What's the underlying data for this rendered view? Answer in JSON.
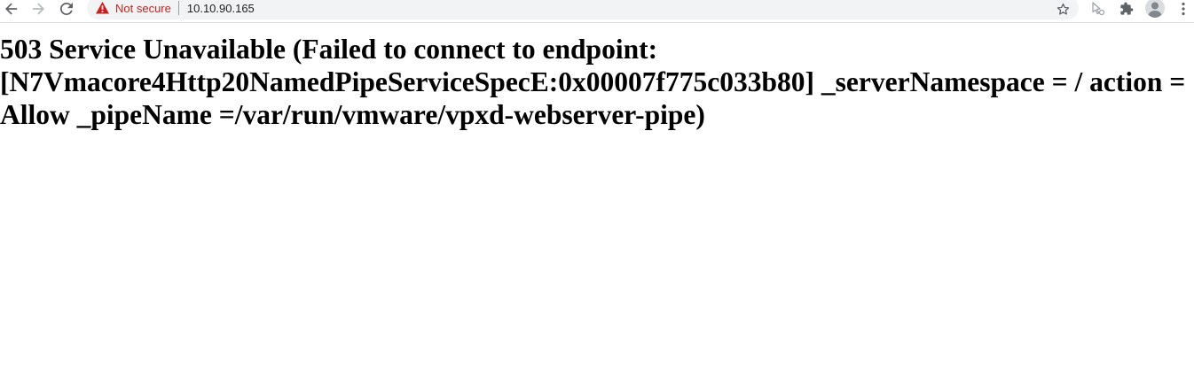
{
  "browser": {
    "omnibox": {
      "security_label": "Not secure",
      "url": "10.10.90.165"
    },
    "icons": {
      "back": "arrow-left-icon",
      "forward": "arrow-right-icon",
      "reload": "reload-icon",
      "security": "warning-triangle-icon",
      "bookmark": "star-icon",
      "extension_1": "cursor-extension-icon",
      "extension_2": "puzzle-icon",
      "profile": "avatar-icon",
      "menu": "kebab-menu-icon"
    },
    "colors": {
      "warning": "#c5221f",
      "icon": "#5f6368",
      "omnibox_bg": "#f1f3f4"
    }
  },
  "page": {
    "heading": "503 Service Unavailable (Failed to connect to endpoint: [N7Vmacore4Http20NamedPipeServiceSpecE:0x00007f775c033b80] _serverNamespace = / action = Allow _pipeName =/var/run/vmware/vpxd-webserver-pipe)"
  }
}
